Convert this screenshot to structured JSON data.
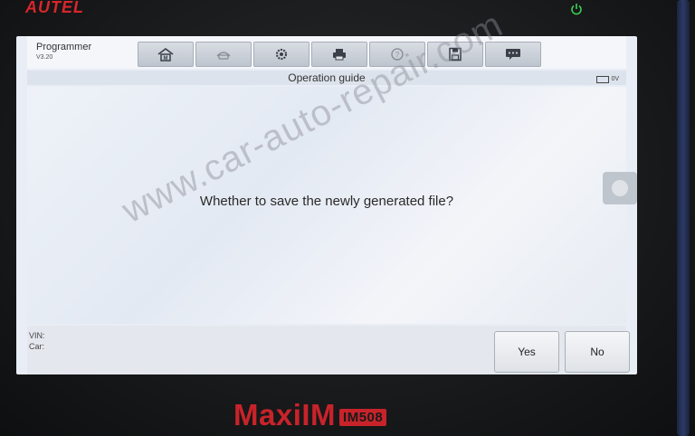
{
  "device": {
    "brand": "AUTEL",
    "model": "MaxiIM",
    "model_badge": "IM508"
  },
  "app": {
    "title": "Programmer",
    "version": "V3.20"
  },
  "toolbar": {
    "buttons": [
      {
        "icon": "home-icon"
      },
      {
        "icon": "vehicle-swap-icon"
      },
      {
        "icon": "gear-icon"
      },
      {
        "icon": "printer-icon"
      },
      {
        "icon": "help-icon"
      },
      {
        "icon": "save-icon"
      },
      {
        "icon": "message-icon"
      }
    ]
  },
  "subbar": {
    "title": "Operation guide",
    "battery": "0V"
  },
  "content": {
    "message": "Whether to save the newly generated file?"
  },
  "footer": {
    "vin_label": "VIN:",
    "car_label": "Car:",
    "yes_label": "Yes",
    "no_label": "No"
  },
  "watermark": "www.car-auto-repair.com"
}
